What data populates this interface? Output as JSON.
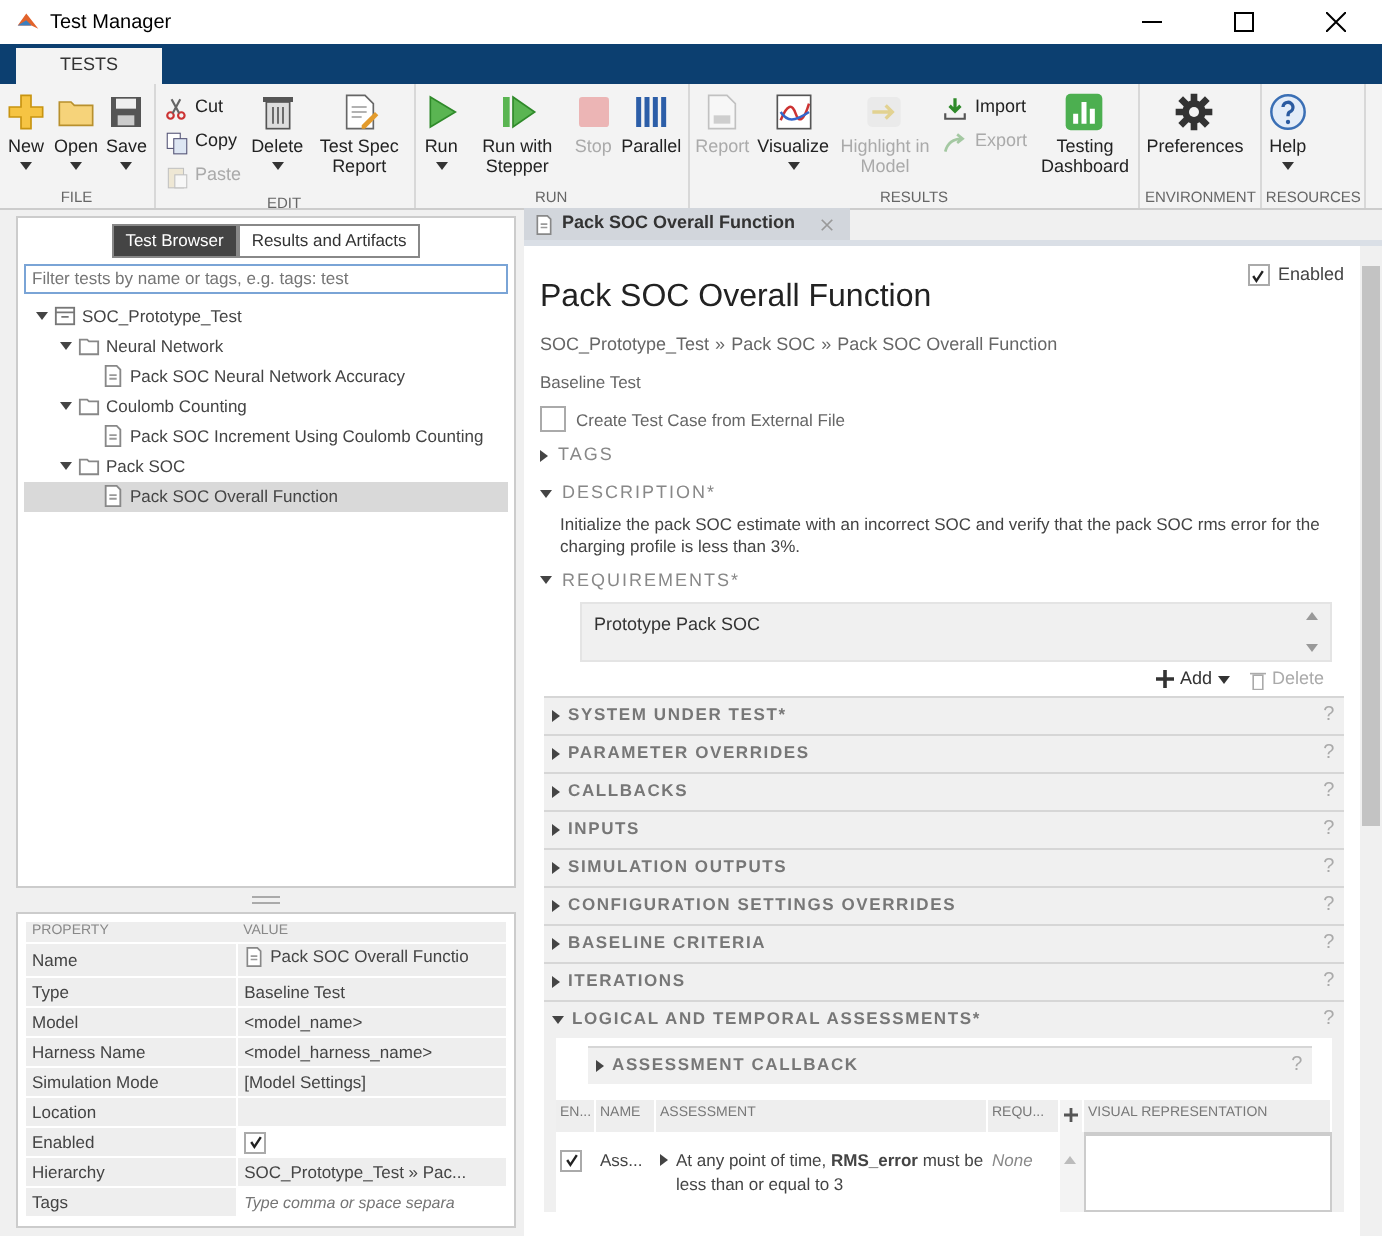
{
  "window": {
    "title": "Test Manager"
  },
  "ribbon_tabs": [
    {
      "label": "TESTS",
      "selected": true
    }
  ],
  "ribbon_groups": [
    {
      "label": "FILE",
      "items": [
        {
          "kind": "large",
          "label": "New",
          "dropdown": true,
          "disabled": false
        },
        {
          "kind": "large",
          "label": "Open",
          "dropdown": true,
          "disabled": false
        },
        {
          "kind": "large",
          "label": "Save",
          "dropdown": true,
          "disabled": false
        }
      ]
    },
    {
      "label": "EDIT",
      "items": [
        {
          "kind": "stack",
          "items": [
            {
              "label": "Cut",
              "disabled": false
            },
            {
              "label": "Copy",
              "disabled": false
            },
            {
              "label": "Paste",
              "disabled": true
            }
          ]
        },
        {
          "kind": "large",
          "label": "Delete",
          "dropdown": true,
          "disabled": false
        },
        {
          "kind": "large",
          "label": "Test Spec Report",
          "dropdown": false,
          "disabled": false
        }
      ]
    },
    {
      "label": "RUN",
      "items": [
        {
          "kind": "large",
          "label": "Run",
          "dropdown": true,
          "disabled": false
        },
        {
          "kind": "large",
          "label": "Run with Stepper",
          "dropdown": false,
          "disabled": false
        },
        {
          "kind": "large",
          "label": "Stop",
          "dropdown": false,
          "disabled": true
        },
        {
          "kind": "large",
          "label": "Parallel",
          "dropdown": false,
          "disabled": false
        }
      ]
    },
    {
      "label": "RESULTS",
      "items": [
        {
          "kind": "large",
          "label": "Report",
          "dropdown": false,
          "disabled": true
        },
        {
          "kind": "large",
          "label": "Visualize",
          "dropdown": true,
          "disabled": false
        },
        {
          "kind": "large",
          "label": "Highlight in Model",
          "dropdown": false,
          "disabled": true
        },
        {
          "kind": "stack",
          "items": [
            {
              "label": "Import",
              "disabled": false
            },
            {
              "label": "Export",
              "disabled": true
            }
          ]
        },
        {
          "kind": "large",
          "label": "Testing Dashboard",
          "dropdown": false,
          "disabled": false
        }
      ]
    },
    {
      "label": "ENVIRONMENT",
      "items": [
        {
          "kind": "large",
          "label": "Preferences",
          "dropdown": false,
          "disabled": false
        }
      ]
    },
    {
      "label": "RESOURCES",
      "items": [
        {
          "kind": "large",
          "label": "Help",
          "dropdown": true,
          "disabled": false
        }
      ]
    }
  ],
  "browser": {
    "tabs": [
      {
        "label": "Test Browser",
        "selected": true
      },
      {
        "label": "Results and Artifacts",
        "selected": false
      }
    ],
    "filter": {
      "placeholder": "Filter tests by name or tags, e.g. tags: test"
    },
    "tree": [
      {
        "label": "SOC_Prototype_Test",
        "kind": "suite",
        "expanded": true,
        "selected": false,
        "children": [
          {
            "label": "Neural Network",
            "kind": "folder",
            "expanded": true,
            "selected": false,
            "children": [
              {
                "label": "Pack SOC Neural Network Accuracy",
                "kind": "case",
                "selected": false
              }
            ]
          },
          {
            "label": "Coulomb Counting",
            "kind": "folder",
            "expanded": true,
            "selected": false,
            "children": [
              {
                "label": "Pack SOC Increment Using Coulomb Counting",
                "kind": "case",
                "selected": false
              }
            ]
          },
          {
            "label": "Pack SOC",
            "kind": "folder",
            "expanded": true,
            "selected": false,
            "children": [
              {
                "label": "Pack SOC Overall Function",
                "kind": "case",
                "selected": true
              }
            ]
          }
        ]
      }
    ]
  },
  "properties": {
    "columns": [
      "PROPERTY",
      "VALUE"
    ],
    "rows": [
      {
        "name": "Name",
        "kind": "file",
        "value": "Pack SOC Overall Functio"
      },
      {
        "name": "Type",
        "kind": "text",
        "value": "Baseline Test"
      },
      {
        "name": "Model",
        "kind": "text",
        "value": "<model_name>"
      },
      {
        "name": "Harness Name",
        "kind": "text",
        "value": "<model_harness_name>"
      },
      {
        "name": "Simulation Mode",
        "kind": "text",
        "value": "[Model Settings]"
      },
      {
        "name": "Location",
        "kind": "text"
      },
      {
        "name": "Enabled",
        "kind": "check",
        "checked": true
      },
      {
        "name": "Hierarchy",
        "kind": "text",
        "value": "SOC_Prototype_Test » Pac..."
      },
      {
        "name": "Tags",
        "kind": "field",
        "placeholder": "Type comma or space separa"
      }
    ]
  },
  "document_tabs": [
    {
      "label": "Pack SOC Overall Function",
      "selected": true
    }
  ],
  "test_case": {
    "title": "Pack SOC Overall Function",
    "enabled": {
      "label": "Enabled",
      "checked": true
    },
    "breadcrumb": [
      {
        "label": "SOC_Prototype_Test",
        "separator": "»"
      },
      {
        "label": "Pack SOC",
        "separator": "»"
      },
      {
        "label": "Pack SOC Overall Function"
      }
    ],
    "type": "Baseline Test",
    "external_file": {
      "label": "Create Test Case from External File",
      "checked": false
    },
    "sections": [
      {
        "label": "TAGS",
        "expanded": false
      },
      {
        "label": "DESCRIPTION*",
        "expanded": true,
        "text": "Initialize the pack SOC estimate with an incorrect SOC and verify that the pack SOC rms error for the charging profile is less than 3%."
      },
      {
        "label": "REQUIREMENTS*",
        "expanded": true,
        "links": [
          "Prototype Pack SOC"
        ],
        "actions": [
          {
            "label": "Add",
            "dropdown": true,
            "disabled": false
          },
          {
            "label": "Delete",
            "dropdown": false,
            "disabled": true
          }
        ]
      }
    ],
    "panels": [
      {
        "label": "SYSTEM UNDER TEST*",
        "expanded": false,
        "help": "?"
      },
      {
        "label": "PARAMETER OVERRIDES",
        "expanded": false,
        "help": "?"
      },
      {
        "label": "CALLBACKS",
        "expanded": false,
        "help": "?"
      },
      {
        "label": "INPUTS",
        "expanded": false,
        "help": "?"
      },
      {
        "label": "SIMULATION OUTPUTS",
        "expanded": false,
        "help": "?"
      },
      {
        "label": "CONFIGURATION SETTINGS OVERRIDES",
        "expanded": false,
        "help": "?"
      },
      {
        "label": "BASELINE CRITERIA",
        "expanded": false,
        "help": "?"
      },
      {
        "label": "ITERATIONS",
        "expanded": false,
        "help": "?"
      },
      {
        "label": "LOGICAL AND TEMPORAL ASSESSMENTS*",
        "expanded": true,
        "help": "?",
        "subpanel": {
          "label": "ASSESSMENT CALLBACK",
          "expanded": false,
          "help": "?"
        },
        "table": {
          "columns": [
            {
              "kind": "text",
              "label": "EN..."
            },
            {
              "kind": "text",
              "label": "NAME"
            },
            {
              "kind": "text",
              "label": "ASSESSMENT"
            },
            {
              "kind": "text",
              "label": "REQU..."
            },
            {
              "kind": "add"
            },
            {
              "kind": "text",
              "label": "VISUAL REPRESENTATION"
            }
          ],
          "rows": [
            {
              "enabled": true,
              "name": "Ass...",
              "expanded": false,
              "assessment": "At any point of time, **RMS_error** must be less than or equal to 3",
              "requirement": "None"
            }
          ]
        }
      }
    ]
  }
}
